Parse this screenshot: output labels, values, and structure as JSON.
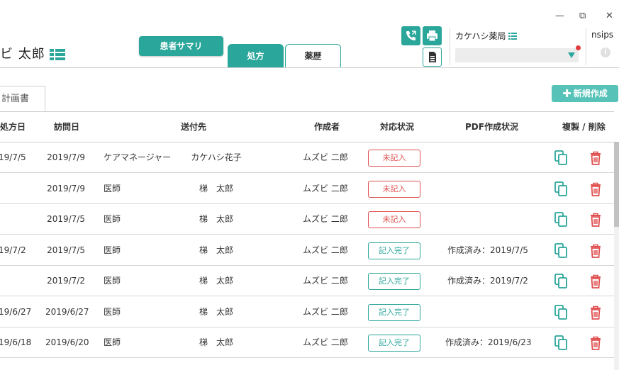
{
  "window": {
    "minimize": "—",
    "restore": "⧉",
    "close": "✕"
  },
  "patient": {
    "name": "ビ 太郎"
  },
  "buttons": {
    "summary": "患者サマリ",
    "new": "新規作成"
  },
  "tabs": [
    {
      "label": "処方"
    },
    {
      "label": "薬歴"
    }
  ],
  "pharmacy": {
    "name": "カケハシ薬局"
  },
  "nsips": {
    "label": "nsips",
    "info": "i"
  },
  "sub_tab": {
    "label": "計画書"
  },
  "table": {
    "headers": {
      "rx_date": "処方日",
      "visit_date": "訪問日",
      "destination": "送付先",
      "author": "作成者",
      "status": "対応状況",
      "pdf_status": "PDF作成状況",
      "copy_delete": "複製 / 削除"
    },
    "rows": [
      {
        "rx_date": "19/7/5",
        "visit_date": "2019/7/9",
        "role": "ケアマネージャー",
        "recipient": "カケハシ花子",
        "author": "ムズビ 二郎",
        "status": "未記入",
        "pdf": ""
      },
      {
        "rx_date": "",
        "visit_date": "2019/7/9",
        "role": "医師",
        "recipient": "梯　太郎",
        "author": "ムズビ 二郎",
        "status": "未記入",
        "pdf": ""
      },
      {
        "rx_date": "",
        "visit_date": "2019/7/5",
        "role": "医師",
        "recipient": "梯　太郎",
        "author": "ムズビ 二郎",
        "status": "未記入",
        "pdf": ""
      },
      {
        "rx_date": "19/7/2",
        "visit_date": "2019/7/5",
        "role": "医師",
        "recipient": "梯　太郎",
        "author": "ムズビ 二郎",
        "status": "記入完了",
        "pdf": "作成済み：2019/7/5"
      },
      {
        "rx_date": "",
        "visit_date": "2019/7/2",
        "role": "医師",
        "recipient": "梯　太郎",
        "author": "ムズビ 二郎",
        "status": "記入完了",
        "pdf": "作成済み：2019/7/2"
      },
      {
        "rx_date": "19/6/27",
        "visit_date": "2019/6/27",
        "role": "医師",
        "recipient": "梯　太郎",
        "author": "ムズビ 二郎",
        "status": "記入完了",
        "pdf": ""
      },
      {
        "rx_date": "19/6/18",
        "visit_date": "2019/6/20",
        "role": "医師",
        "recipient": "梯　太郎",
        "author": "ムズビ 二郎",
        "status": "記入完了",
        "pdf": "作成済み：2019/6/23"
      }
    ]
  },
  "colors": {
    "accent": "#2aa69a",
    "danger": "#e05050"
  },
  "icons": {
    "phone": "phone-icon",
    "print": "printer-icon",
    "doc": "document-icon",
    "copy": "copy-icon",
    "delete": "trash-icon",
    "list": "grid-list-icon"
  }
}
